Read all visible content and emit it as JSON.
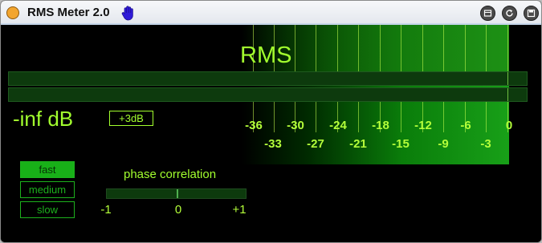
{
  "window": {
    "title": "RMS Meter 2.0",
    "accent": "#a2ff2e",
    "button_icons": [
      "pin-icon",
      "refresh-icon",
      "save-icon"
    ]
  },
  "meter": {
    "label": "RMS",
    "readout": "-inf dB",
    "boost_label": "+3dB",
    "scale_upper": [
      "-36",
      "-30",
      "-24",
      "-18",
      "-12",
      "-6",
      "0"
    ],
    "scale_lower": [
      "-33",
      "-27",
      "-21",
      "-15",
      "-9",
      "-3"
    ]
  },
  "speed": {
    "options": [
      "fast",
      "medium",
      "slow"
    ],
    "selected": "fast"
  },
  "phase": {
    "label": "phase correlation",
    "ticks": [
      "-1",
      "0",
      "+1"
    ],
    "value": 0
  }
}
